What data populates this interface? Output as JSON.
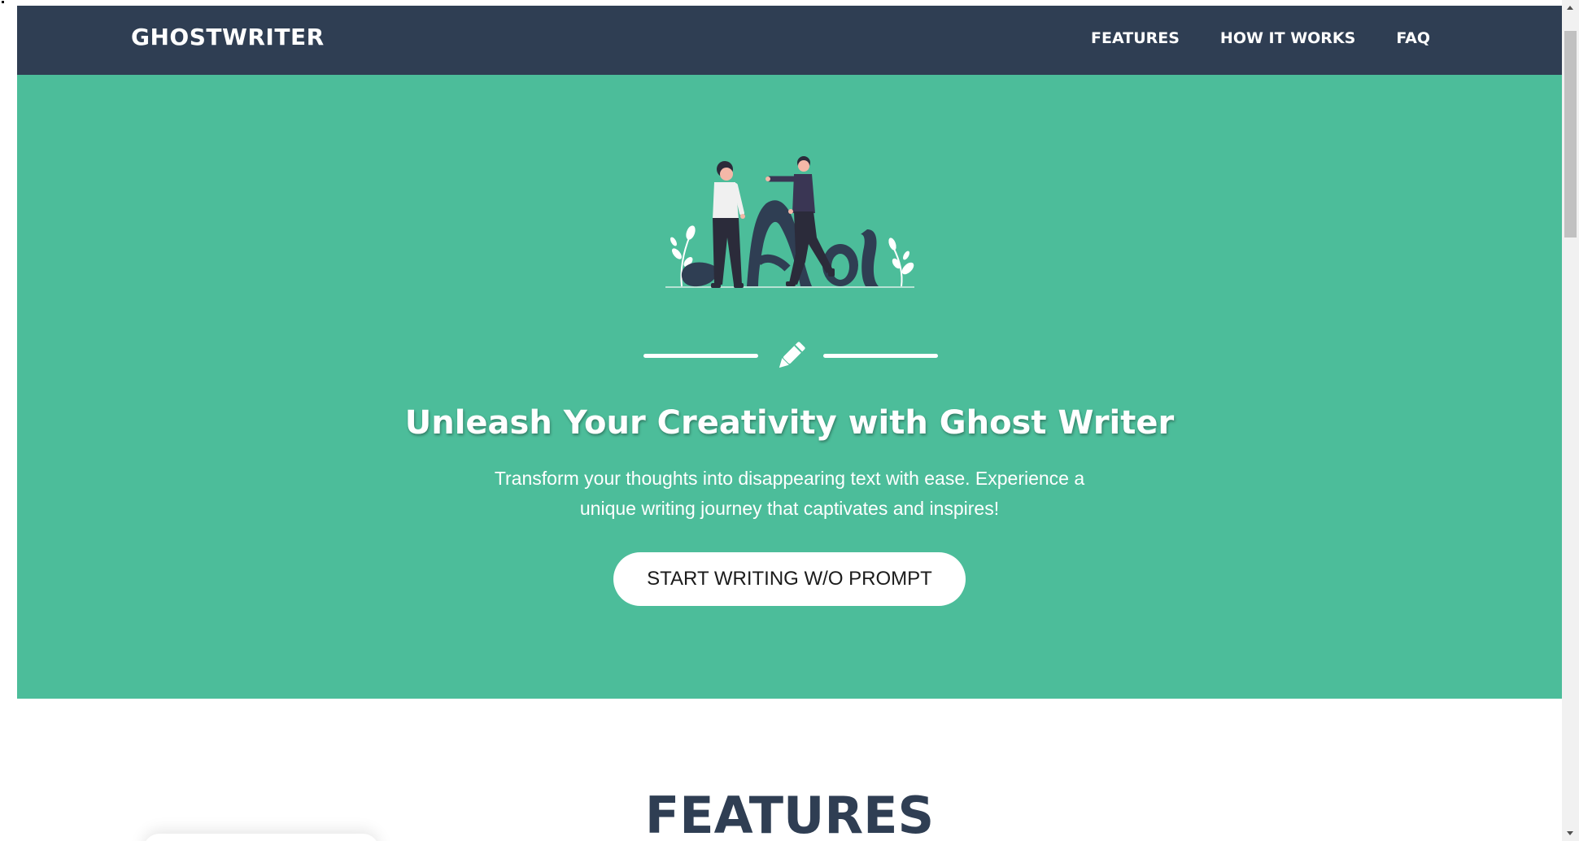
{
  "navbar": {
    "brand": "GHOSTWRITER",
    "links": [
      "FEATURES",
      "HOW IT WORKS",
      "FAQ"
    ]
  },
  "hero": {
    "illustration_icon": "people-with-letters-illustration",
    "divider_icon": "pencil-icon",
    "headline": "Unleash Your Creativity with Ghost Writer",
    "subtext": "Transform your thoughts into disappearing text with ease. Experience a unique writing journey that captivates and inspires!",
    "cta_label": "START WRITING W/O PROMPT"
  },
  "features": {
    "title": "FEATURES"
  },
  "colors": {
    "navbar": "#2f3e53",
    "hero": "#4cbd9a",
    "heading": "#2f3e53"
  }
}
